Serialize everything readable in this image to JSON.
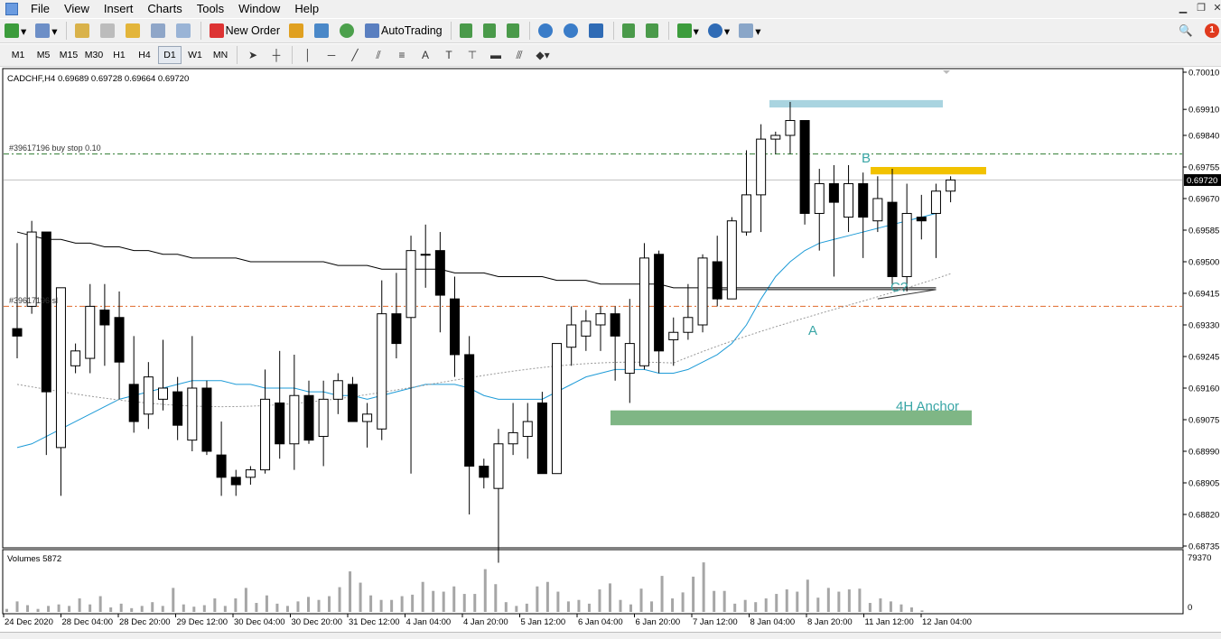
{
  "menu": {
    "items": [
      "File",
      "View",
      "Insert",
      "Charts",
      "Tools",
      "Window",
      "Help"
    ]
  },
  "toolbar": {
    "new_order_label": "New Order",
    "autotrading_label": "AutoTrading"
  },
  "timeframes": {
    "items": [
      "M1",
      "M5",
      "M15",
      "M30",
      "H1",
      "H4",
      "D1",
      "W1",
      "MN"
    ],
    "active": "D1"
  },
  "drawing_tools": [
    "cursor-icon",
    "crosshair-icon",
    "vertical-line-icon",
    "horizontal-line-icon",
    "trendline-icon",
    "channel-icon",
    "fibonacci-icon",
    "text-label-icon",
    "text-tool-icon",
    "arrow-label-icon",
    "rectangle-icon",
    "parallel-lines-icon",
    "shapes-icon"
  ],
  "chart": {
    "header": "CADCHF,H4  0.69689 0.69728 0.69664 0.69720",
    "buy_stop_label": "#39617196 buy stop 0.10",
    "sl_label": "#39617196 sl",
    "current_price": "0.69720",
    "annotations": {
      "A": "A",
      "B": "B",
      "C": "C?",
      "anchor": "4H Anchor"
    },
    "volumes_label": "Volumes 5872",
    "volume_max_label": "79370",
    "volume_zero_label": "0"
  },
  "colors": {
    "bull": "#ffffff",
    "bear": "#000000",
    "ma_fast": "#1e9bd7",
    "ma_slow": "#000000",
    "buy_stop_line": "#2e7d32",
    "sl_line": "#e06a2a",
    "anchor_zone": "#7fb685",
    "resistance_zone": "#f2c200",
    "top_zone": "#a9d4e0",
    "annotation_text": "#3aa6a6"
  },
  "chart_data": {
    "type": "candlestick",
    "symbol": "CADCHF",
    "timeframe": "H4",
    "ylim": [
      0.68735,
      0.7001
    ],
    "y_ticks": [
      "0.70010",
      "0.69910",
      "0.69840",
      "0.69755",
      "0.69670",
      "0.69585",
      "0.69500",
      "0.69415",
      "0.69330",
      "0.69245",
      "0.69160",
      "0.69075",
      "0.68990",
      "0.68905",
      "0.68820",
      "0.68735"
    ],
    "x_ticks": [
      "24 Dec 2020",
      "28 Dec 04:00",
      "28 Dec 20:00",
      "29 Dec 12:00",
      "30 Dec 04:00",
      "30 Dec 20:00",
      "31 Dec 12:00",
      "4 Jan 04:00",
      "4 Jan 20:00",
      "5 Jan 12:00",
      "6 Jan 04:00",
      "6 Jan 20:00",
      "7 Jan 12:00",
      "8 Jan 04:00",
      "8 Jan 20:00",
      "11 Jan 12:00",
      "12 Jan 04:00"
    ],
    "candles": [
      [
        0.6932,
        0.6955,
        0.6924,
        0.693
      ],
      [
        0.6938,
        0.6961,
        0.6936,
        0.6958
      ],
      [
        0.6958,
        0.6958,
        0.6898,
        0.6915
      ],
      [
        0.69,
        0.6938,
        0.6887,
        0.6943
      ],
      [
        0.6922,
        0.6928,
        0.692,
        0.6926
      ],
      [
        0.6924,
        0.6944,
        0.692,
        0.6938
      ],
      [
        0.6937,
        0.6944,
        0.6922,
        0.6933
      ],
      [
        0.6935,
        0.6942,
        0.6913,
        0.6923
      ],
      [
        0.6917,
        0.693,
        0.6904,
        0.6907
      ],
      [
        0.6909,
        0.6923,
        0.6905,
        0.6919
      ],
      [
        0.6913,
        0.6929,
        0.691,
        0.6916
      ],
      [
        0.6915,
        0.6919,
        0.6902,
        0.6906
      ],
      [
        0.6902,
        0.693,
        0.6899,
        0.6916
      ],
      [
        0.6916,
        0.6918,
        0.6898,
        0.6899
      ],
      [
        0.6898,
        0.6907,
        0.6887,
        0.6892
      ],
      [
        0.6892,
        0.6894,
        0.6887,
        0.689
      ],
      [
        0.6892,
        0.6895,
        0.689,
        0.6894
      ],
      [
        0.6894,
        0.6921,
        0.6893,
        0.6913
      ],
      [
        0.6912,
        0.6926,
        0.6897,
        0.6901
      ],
      [
        0.6901,
        0.6925,
        0.6894,
        0.6914
      ],
      [
        0.6914,
        0.6918,
        0.6901,
        0.6902
      ],
      [
        0.6903,
        0.6918,
        0.6895,
        0.6913
      ],
      [
        0.6913,
        0.692,
        0.6909,
        0.6918
      ],
      [
        0.6917,
        0.6919,
        0.6908,
        0.6907
      ],
      [
        0.6907,
        0.6912,
        0.69,
        0.6909
      ],
      [
        0.6905,
        0.6945,
        0.6902,
        0.6936
      ],
      [
        0.6936,
        0.6947,
        0.6924,
        0.6928
      ],
      [
        0.6935,
        0.6957,
        0.6893,
        0.6953
      ],
      [
        0.6952,
        0.696,
        0.6943,
        0.6952
      ],
      [
        0.6953,
        0.6958,
        0.6931,
        0.6941
      ],
      [
        0.694,
        0.6946,
        0.6919,
        0.6925
      ],
      [
        0.6925,
        0.693,
        0.6882,
        0.6895
      ],
      [
        0.6895,
        0.6897,
        0.6889,
        0.6892
      ],
      [
        0.6889,
        0.6905,
        0.6869,
        0.6901
      ],
      [
        0.6901,
        0.6912,
        0.6898,
        0.6904
      ],
      [
        0.6903,
        0.6912,
        0.6897,
        0.6907
      ],
      [
        0.6912,
        0.6915,
        0.6894,
        0.6893
      ],
      [
        0.6893,
        0.6917,
        0.6893,
        0.6928
      ],
      [
        0.6927,
        0.6938,
        0.6922,
        0.6933
      ],
      [
        0.693,
        0.6937,
        0.6926,
        0.6934
      ],
      [
        0.6933,
        0.6938,
        0.6926,
        0.6936
      ],
      [
        0.6936,
        0.6938,
        0.6918,
        0.693
      ],
      [
        0.692,
        0.694,
        0.6912,
        0.6928
      ],
      [
        0.6922,
        0.6955,
        0.6921,
        0.6951
      ],
      [
        0.6952,
        0.6953,
        0.692,
        0.6926
      ],
      [
        0.6929,
        0.6935,
        0.6922,
        0.6931
      ],
      [
        0.6931,
        0.6944,
        0.6929,
        0.6935
      ],
      [
        0.6933,
        0.6952,
        0.6931,
        0.6951
      ],
      [
        0.695,
        0.6957,
        0.6938,
        0.694
      ],
      [
        0.694,
        0.6962,
        0.694,
        0.6961
      ],
      [
        0.6958,
        0.698,
        0.6957,
        0.6968
      ],
      [
        0.6968,
        0.6987,
        0.6958,
        0.6983
      ],
      [
        0.6983,
        0.6985,
        0.6979,
        0.6984
      ],
      [
        0.6984,
        0.6993,
        0.6979,
        0.6988
      ],
      [
        0.6988,
        0.6988,
        0.696,
        0.6963
      ],
      [
        0.6963,
        0.6975,
        0.6953,
        0.6971
      ],
      [
        0.6971,
        0.6976,
        0.6946,
        0.6966
      ],
      [
        0.6962,
        0.6976,
        0.6958,
        0.6971
      ],
      [
        0.6971,
        0.6974,
        0.6951,
        0.6962
      ],
      [
        0.6961,
        0.6973,
        0.6958,
        0.6967
      ],
      [
        0.6966,
        0.6975,
        0.6944,
        0.6946
      ],
      [
        0.6946,
        0.6971,
        0.6942,
        0.6963
      ],
      [
        0.6962,
        0.6968,
        0.6956,
        0.6961
      ],
      [
        0.6963,
        0.6971,
        0.6951,
        0.6969
      ],
      [
        0.6969,
        0.6973,
        0.6966,
        0.6972
      ]
    ],
    "volumes": [
      4000,
      14000,
      9000,
      4000,
      8000,
      10000,
      8000,
      18000,
      10000,
      21000,
      6000,
      11000,
      5000,
      8000,
      13000,
      8000,
      32000,
      10000,
      7000,
      9000,
      18000,
      8000,
      18000,
      32000,
      12000,
      22000,
      11000,
      8000,
      14000,
      20000,
      16000,
      21000,
      33000,
      54000,
      39000,
      22000,
      16000,
      16000,
      21000,
      23000,
      40000,
      28000,
      27000,
      34000,
      24000,
      24000,
      57000,
      37000,
      13000,
      8000,
      11000,
      34000,
      40000,
      27000,
      14000,
      16000,
      11000,
      30000,
      38000,
      16000,
      10000,
      31000,
      14000,
      48000,
      18000,
      26000,
      47000,
      66000,
      28000,
      28000,
      11000,
      16000,
      13000,
      18000,
      24000,
      30000,
      27000,
      43000,
      19000,
      32000,
      27000,
      30000,
      31000,
      12000,
      18000,
      14000,
      10000,
      6000,
      2000
    ],
    "series": [
      {
        "name": "MA fast",
        "values": [
          0.69,
          0.6901,
          0.6903,
          0.6905,
          0.6907,
          0.6909,
          0.6911,
          0.6913,
          0.6914,
          0.6915,
          0.6916,
          0.6917,
          0.6918,
          0.6918,
          0.6918,
          0.6917,
          0.6917,
          0.6916,
          0.6916,
          0.6916,
          0.6915,
          0.6915,
          0.6914,
          0.6914,
          0.6913,
          0.6914,
          0.6915,
          0.6916,
          0.6917,
          0.6917,
          0.6917,
          0.6916,
          0.6914,
          0.6913,
          0.6913,
          0.6913,
          0.6913,
          0.6915,
          0.6917,
          0.6919,
          0.692,
          0.6921,
          0.6921,
          0.6921,
          0.692,
          0.692,
          0.6921,
          0.6923,
          0.6925,
          0.6928,
          0.6933,
          0.694,
          0.6946,
          0.695,
          0.6953,
          0.6955,
          0.6956,
          0.6957,
          0.6958,
          0.6959,
          0.696,
          0.6961,
          0.6962,
          0.6963
        ]
      },
      {
        "name": "MA slow",
        "values": [
          0.6958,
          0.6957,
          0.6956,
          0.6956,
          0.6955,
          0.6955,
          0.6954,
          0.6954,
          0.6953,
          0.6953,
          0.6952,
          0.6952,
          0.6951,
          0.6951,
          0.6951,
          0.6951,
          0.695,
          0.695,
          0.695,
          0.695,
          0.695,
          0.695,
          0.6949,
          0.6949,
          0.6949,
          0.6948,
          0.6948,
          0.6948,
          0.6948,
          0.6948,
          0.6947,
          0.6947,
          0.6947,
          0.6946,
          0.6946,
          0.6946,
          0.6946,
          0.6945,
          0.6945,
          0.6945,
          0.6944,
          0.6944,
          0.6944,
          0.6944,
          0.6944,
          0.6943,
          0.6943,
          0.6943,
          0.6943,
          0.6943,
          0.6943,
          0.6943,
          0.6943,
          0.6943,
          0.6943,
          0.6943,
          0.6943,
          0.6943,
          0.6943,
          0.6943,
          0.6943,
          0.6943,
          0.6943,
          0.6943
        ]
      }
    ],
    "levels": {
      "buy_stop": 0.6979,
      "sl": 0.6938,
      "current": 0.6972
    },
    "zones": {
      "anchor": [
        0.6906,
        0.691
      ],
      "resistance": [
        0.69735,
        0.69755
      ],
      "top": [
        0.69915,
        0.69935
      ]
    },
    "grid": false,
    "legend": "top-left"
  }
}
